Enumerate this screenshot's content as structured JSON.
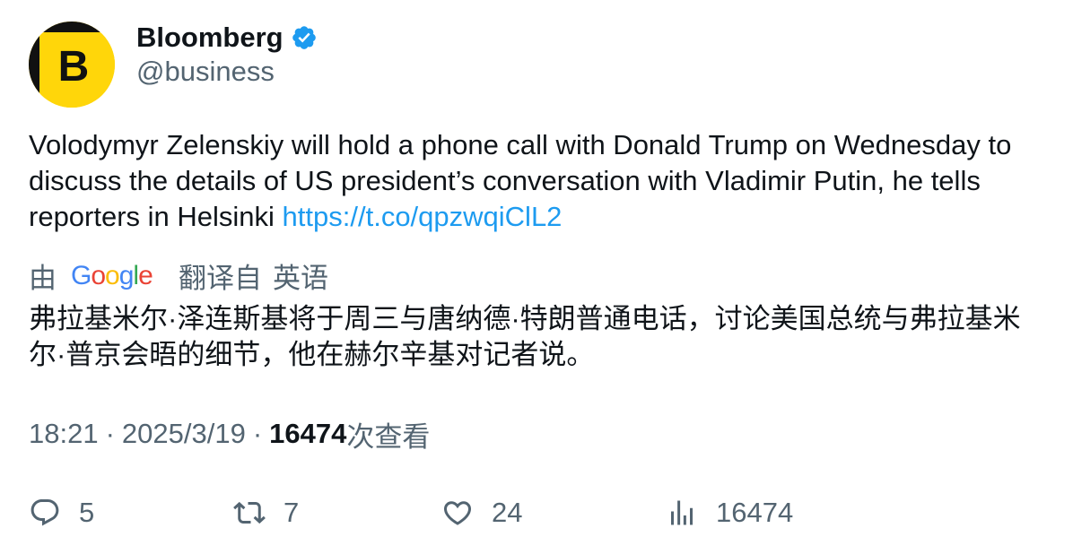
{
  "author": {
    "display_name": "Bloomberg",
    "handle": "@business",
    "avatar_letter": "B",
    "verified": true
  },
  "tweet": {
    "text": "Volodymyr Zelenskiy will hold a phone call with Donald Trump on Wednesday to discuss the details of US president’s conversation with Vladimir Putin, he tells reporters in Helsinki ",
    "link": "https://t.co/qpzwqiClL2"
  },
  "translation": {
    "prefix": "由",
    "provider": "Google",
    "label": "翻译自",
    "source_language": "英语",
    "text": "弗拉基米尔·泽连斯基将于周三与唐纳德·特朗普通电话，讨论美国总统与弗拉基米尔·普京会晤的细节，他在赫尔辛基对记者说。"
  },
  "meta": {
    "time": "18:21",
    "separator": "·",
    "date": "2025/3/19",
    "views_count": "16474",
    "views_label": "次查看"
  },
  "actions": {
    "replies": "5",
    "retweets": "7",
    "likes": "24",
    "views": "16474"
  },
  "colors": {
    "text_primary": "#0f1419",
    "text_secondary": "#536471",
    "link": "#1d9bf0",
    "verified_badge": "#1d9bf0",
    "avatar_bg": "#ffd60a"
  },
  "icons": {
    "verified": "verified-badge-icon",
    "reply": "reply-icon",
    "retweet": "retweet-icon",
    "like": "heart-icon",
    "views": "views-bar-chart-icon"
  }
}
